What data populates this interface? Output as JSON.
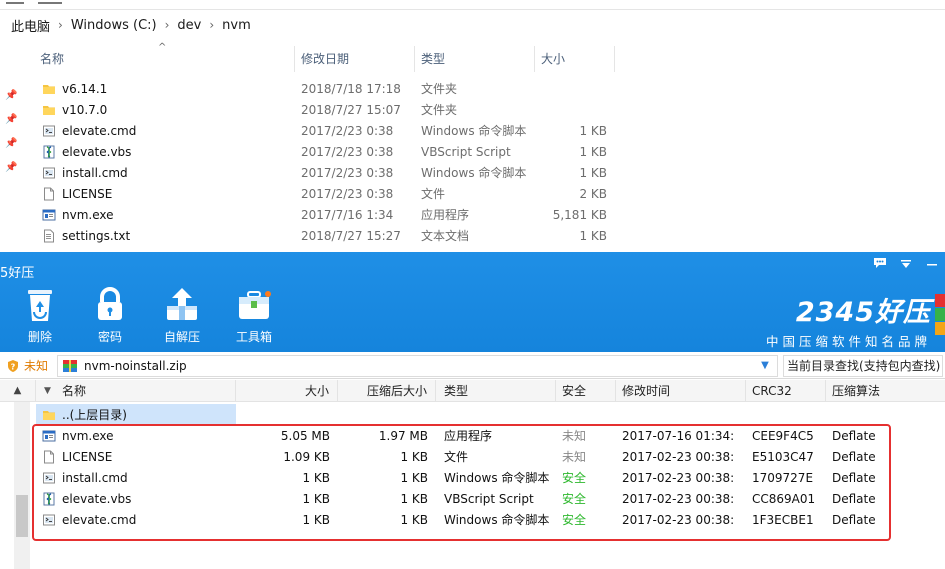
{
  "explorer": {
    "breadcrumb": [
      "此电脑",
      "Windows (C:)",
      "dev",
      "nvm"
    ],
    "columns": {
      "name": "名称",
      "date": "修改日期",
      "type": "类型",
      "size": "大小"
    },
    "files": [
      {
        "name": "v6.14.1",
        "date": "2018/7/18 17:18",
        "type": "文件夹",
        "size": "",
        "icon": "folder-icon"
      },
      {
        "name": "v10.7.0",
        "date": "2018/7/27 15:07",
        "type": "文件夹",
        "size": "",
        "icon": "folder-icon"
      },
      {
        "name": "elevate.cmd",
        "date": "2017/2/23 0:38",
        "type": "Windows 命令脚本",
        "size": "1 KB",
        "icon": "cmd-file-icon"
      },
      {
        "name": "elevate.vbs",
        "date": "2017/2/23 0:38",
        "type": "VBScript Script",
        "size": "1 KB",
        "icon": "vbs-file-icon"
      },
      {
        "name": "install.cmd",
        "date": "2017/2/23 0:38",
        "type": "Windows 命令脚本",
        "size": "1 KB",
        "icon": "cmd-file-icon"
      },
      {
        "name": "LICENSE",
        "date": "2017/2/23 0:38",
        "type": "文件",
        "size": "2 KB",
        "icon": "blank-file-icon"
      },
      {
        "name": "nvm.exe",
        "date": "2017/7/16 1:34",
        "type": "应用程序",
        "size": "5,181 KB",
        "icon": "exe-file-icon"
      },
      {
        "name": "settings.txt",
        "date": "2018/7/27 15:27",
        "type": "文本文档",
        "size": "1 KB",
        "icon": "txt-file-icon"
      }
    ]
  },
  "zip": {
    "title": "5好压",
    "toolbar": [
      {
        "label": "删除",
        "icon": "recycle-bin-icon"
      },
      {
        "label": "密码",
        "icon": "lock-icon"
      },
      {
        "label": "自解压",
        "icon": "self-extract-icon"
      },
      {
        "label": "工具箱",
        "icon": "toolbox-icon"
      }
    ],
    "brand": {
      "logo": "2345好压",
      "tagline": "中国压缩软件知名品牌"
    },
    "status": "未知",
    "path": "nvm-noinstall.zip",
    "search_placeholder": "当前目录查找(支持包内查找)",
    "columns": {
      "name": "名称",
      "size": "大小",
      "csize": "压缩后大小",
      "type": "类型",
      "safe": "安全",
      "mtime": "修改时间",
      "crc": "CRC32",
      "method": "压缩算法"
    },
    "parent_label": "..(上层目录)",
    "files": [
      {
        "name": "nvm.exe",
        "size": "5.05 MB",
        "csize": "1.97 MB",
        "type": "应用程序",
        "safe": "未知",
        "mtime": "2017-07-16 01:34:",
        "crc": "CEE9F4C5",
        "method": "Deflate",
        "icon": "exe-file-icon"
      },
      {
        "name": "LICENSE",
        "size": "1.09 KB",
        "csize": "1 KB",
        "type": "文件",
        "safe": "未知",
        "mtime": "2017-02-23 00:38:",
        "crc": "E5103C47",
        "method": "Deflate",
        "icon": "blank-file-icon"
      },
      {
        "name": "install.cmd",
        "size": "1 KB",
        "csize": "1 KB",
        "type": "Windows 命令脚本",
        "safe": "安全",
        "mtime": "2017-02-23 00:38:",
        "crc": "1709727E",
        "method": "Deflate",
        "icon": "cmd-file-icon"
      },
      {
        "name": "elevate.vbs",
        "size": "1 KB",
        "csize": "1 KB",
        "type": "VBScript Script",
        "safe": "安全",
        "mtime": "2017-02-23 00:38:",
        "crc": "CC869A01",
        "method": "Deflate",
        "icon": "vbs-file-icon"
      },
      {
        "name": "elevate.cmd",
        "size": "1 KB",
        "csize": "1 KB",
        "type": "Windows 命令脚本",
        "safe": "安全",
        "mtime": "2017-02-23 00:38:",
        "crc": "1F3ECBE1",
        "method": "Deflate",
        "icon": "cmd-file-icon"
      }
    ],
    "colors": {
      "titlebar": "#1584dc",
      "safe": "#2eb82e",
      "unknown": "#888888",
      "highlight": "#e53030"
    }
  }
}
